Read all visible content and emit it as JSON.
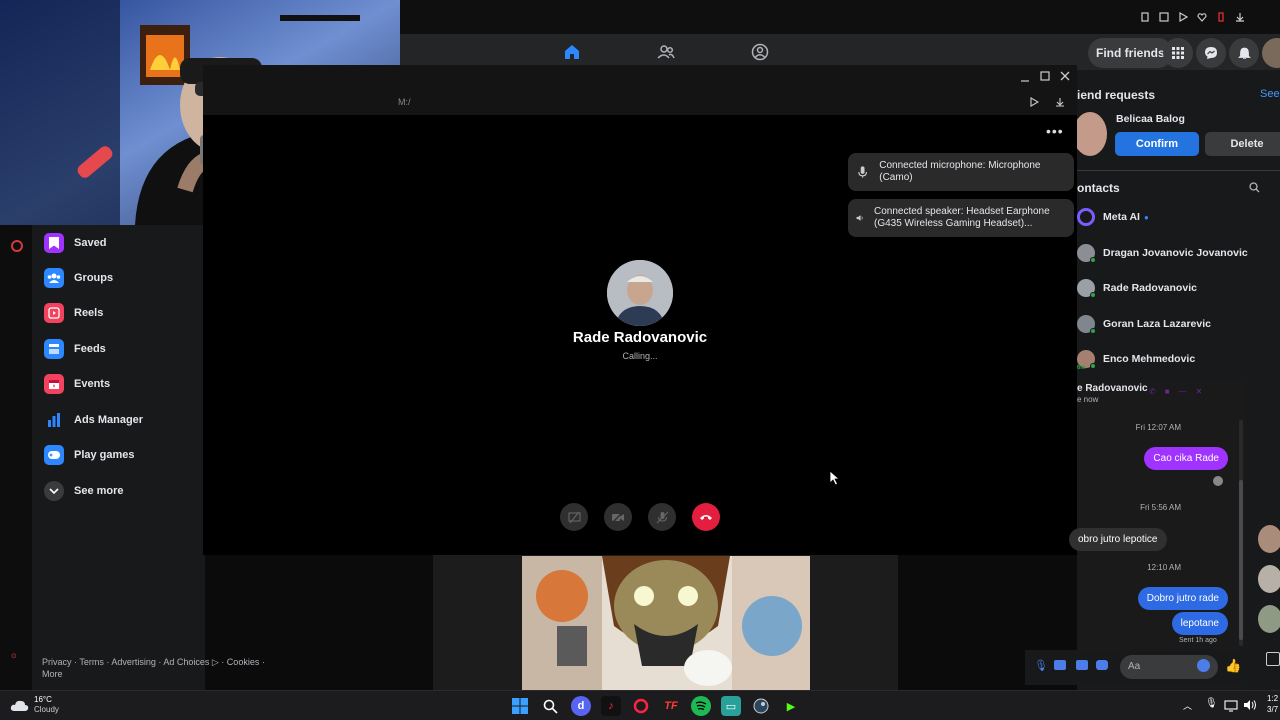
{
  "facebook": {
    "find_friends": "Find friends"
  },
  "sidebar": {
    "items": [
      {
        "label": "Saved",
        "icon": "bookmark-icon",
        "color": "#a033ff"
      },
      {
        "label": "Groups",
        "icon": "groups-icon",
        "color": "#2d88ff"
      },
      {
        "label": "Reels",
        "icon": "reels-icon",
        "color": "#f3425f"
      },
      {
        "label": "Feeds",
        "icon": "feeds-icon",
        "color": "#2d88ff"
      },
      {
        "label": "Events",
        "icon": "calendar-icon",
        "color": "#f3425f"
      },
      {
        "label": "Ads Manager",
        "icon": "bar-chart-icon",
        "color": "#2d88ff"
      },
      {
        "label": "Play games",
        "icon": "gamepad-icon",
        "color": "#2d88ff"
      },
      {
        "label": "See more",
        "icon": "chevron-down-icon",
        "color": "#3a3b3c"
      }
    ],
    "footer": "Privacy · Terms · Advertising · Ad Choices ▷ · Cookies · More"
  },
  "call": {
    "address": "M:/",
    "contact_name": "Rade Radovanovic",
    "status": "Calling...",
    "toasts": [
      {
        "text": "Connected microphone: Microphone (Camo)",
        "icon": "microphone-icon"
      },
      {
        "text": "Connected speaker: Headset Earphone (G435 Wireless Gaming Headset)...",
        "icon": "speaker-icon"
      }
    ]
  },
  "right_panel": {
    "friend_requests_title": "iend requests",
    "see_all": "See",
    "request_name": "Belicaa Balog",
    "confirm": "Confirm",
    "delete": "Delete",
    "contacts_title": "ontacts",
    "contacts": [
      {
        "name": "Meta AI",
        "verified": true
      },
      {
        "name": "Dragan Jovanovic Jovanovic"
      },
      {
        "name": "Rade Radovanovic"
      },
      {
        "name": "Goran Laza Lazarevic"
      },
      {
        "name": "Enco Mehmedovic",
        "badge": "6m"
      }
    ]
  },
  "chat": {
    "header_name": "e Radovanovic",
    "header_status": "e now",
    "messages": [
      {
        "type": "time",
        "text": "Fri 12:07 AM"
      },
      {
        "type": "out",
        "text": "Cao cika Rade",
        "color": "#a033ff"
      },
      {
        "type": "time",
        "text": "Fri 5:56 AM"
      },
      {
        "type": "in",
        "text": "obro jutro lepotice"
      },
      {
        "type": "time",
        "text": "12:10 AM"
      },
      {
        "type": "out",
        "text": "Dobro jutro rade",
        "color": "#2d6ae3"
      },
      {
        "type": "out",
        "text": "lepotane",
        "color": "#2d6ae3"
      }
    ],
    "sent_label": "Sent 1h ago",
    "composer_placeholder": "Aa"
  },
  "taskbar": {
    "weather_temp": "16°C",
    "weather_desc": "Cloudy",
    "clock_time": "1:2",
    "clock_date": "3/7"
  }
}
